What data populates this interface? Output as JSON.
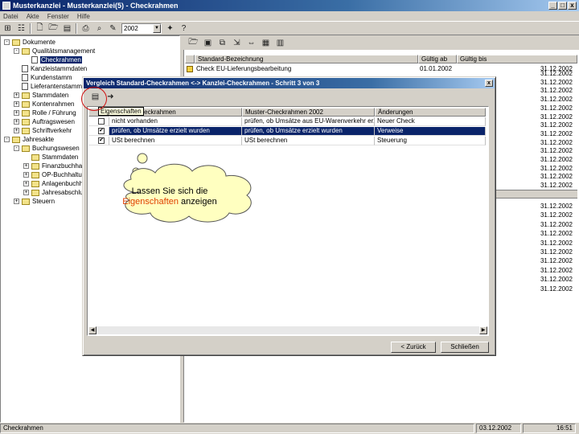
{
  "window": {
    "title": "Musterkanzlei - Musterkanzlei(5) - Checkrahmen",
    "controls": [
      "_",
      "□",
      "x"
    ]
  },
  "menu": [
    "Datei",
    "Akte",
    "Fenster",
    "Hilfe"
  ],
  "toolbar": {
    "year": "2002"
  },
  "tree": {
    "items": [
      {
        "label": "Dokumente",
        "type": "folder",
        "exp": "-"
      },
      {
        "label": "Qualitätsmanagement",
        "type": "folder",
        "exp": "-"
      },
      {
        "label": "Checkrahmen",
        "type": "doc",
        "selected": true
      },
      {
        "label": "Kanzleistammdaten",
        "type": "doc"
      },
      {
        "label": "Kundenstamm",
        "type": "doc"
      },
      {
        "label": "Lieferantenstamm",
        "type": "doc"
      },
      {
        "label": "Stammdaten",
        "type": "folder",
        "exp": "+"
      },
      {
        "label": "Kontenrahmen",
        "type": "folder",
        "exp": "+"
      },
      {
        "label": "Rolle / Führung",
        "type": "folder",
        "exp": "+"
      },
      {
        "label": "Auftragswesen",
        "type": "folder",
        "exp": "+"
      },
      {
        "label": "Schriftverkehr",
        "type": "folder",
        "exp": "+"
      },
      {
        "label": "Jahresakte",
        "type": "folder",
        "exp": "-"
      },
      {
        "label": "Buchungswesen",
        "type": "folder",
        "exp": "-"
      },
      {
        "label": "Stammdaten",
        "type": "folder",
        "exp": ""
      },
      {
        "label": "Finanzbuchhaltung",
        "type": "folder",
        "exp": "+"
      },
      {
        "label": "OP-Buchhaltung",
        "type": "folder",
        "exp": "+"
      },
      {
        "label": "Anlagenbuchhaltung",
        "type": "folder",
        "exp": "+"
      },
      {
        "label": "Jahresabschluss",
        "type": "folder",
        "exp": "+"
      },
      {
        "label": "Steuern",
        "type": "folder",
        "exp": "+"
      }
    ]
  },
  "right": {
    "columns": [
      "Standard-Bezeichnung",
      "Gültig ab",
      "Gültig bis"
    ],
    "first_row": {
      "name": "Check EU-Lieferungsbearbeitung",
      "from": "01.01.2002",
      "to": "31.12.2002"
    },
    "dates": [
      "31.12.2002",
      "31.12.2002",
      "31.12.2002",
      "31.12.2002",
      "31.12.2002",
      "31.12.2002",
      "31.12.2002",
      "31.12.2002",
      "31.12.2002",
      "31.12.2002",
      "31.12.2002",
      "31.12.2002",
      "31.12.2002",
      "31.12.2002",
      "31.12.2002",
      "31.12.2002",
      "31.12.2002",
      "31.12.2002",
      "31.12.2002",
      "31.12.2002",
      "31.12.2002",
      "31.12.2002",
      "31.12.2002",
      "31.12.2002"
    ]
  },
  "dialog": {
    "title": "Vergleich Standard-Checkrahmen <-> Kanzlei-Checkrahmen - Schritt 3 von 3",
    "tooltip": "Eigenschaften",
    "columns": [
      "",
      "Kanzlei-Checkrahmen",
      "Muster-Checkrahmen 2002",
      "Änderungen"
    ],
    "rows": [
      {
        "checked": false,
        "kanzlei": "nicht vorhanden",
        "muster": "prüfen, ob Umsätze aus EU-Warenverkehr erz",
        "change": "Neuer Check",
        "selected": false
      },
      {
        "checked": true,
        "kanzlei": "prüfen, ob Umsätze erzielt wurden",
        "muster": "prüfen, ob Umsätze erzielt wurden",
        "change": "Verweise",
        "selected": true
      },
      {
        "checked": true,
        "kanzlei": "USt berechnen",
        "muster": "USt berechnen",
        "change": "Steuerung",
        "selected": false
      }
    ],
    "back_button": "< Zurück",
    "close_button": "Schließen"
  },
  "callout": {
    "text_before": "Lassen Sie sich die ",
    "highlight": "Eigenschaften",
    "text_after": " anzeigen"
  },
  "statusbar": {
    "left": "Checkrahmen",
    "date": "03.12.2002",
    "time": "16:51"
  }
}
